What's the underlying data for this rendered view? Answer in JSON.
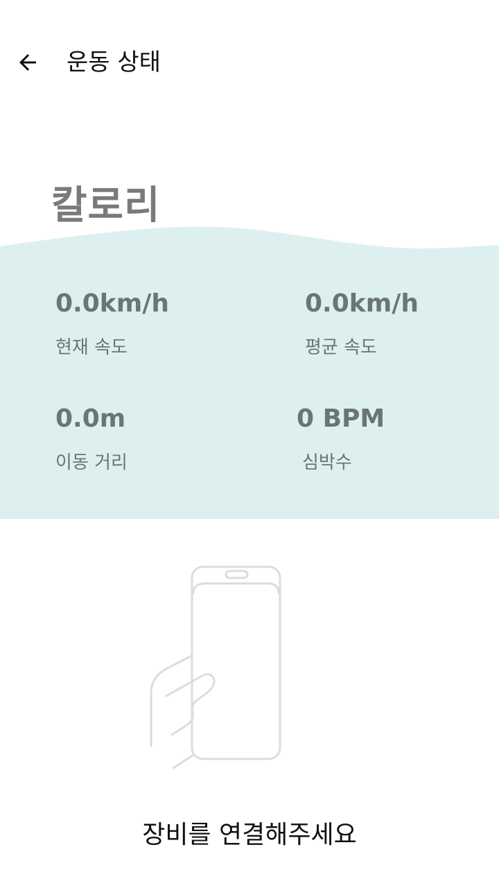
{
  "header": {
    "title": "운동 상태",
    "back_icon": "arrow-left-icon"
  },
  "calorie": {
    "title": "칼로리"
  },
  "stats": {
    "current_speed": {
      "value": "0.0km/h",
      "label": "현재 속도"
    },
    "average_speed": {
      "value": "0.0km/h",
      "label": "평균 속도"
    },
    "distance": {
      "value": "0.0m",
      "label": "이동 거리"
    },
    "heart_rate": {
      "value": "0 BPM",
      "label": "심박수"
    }
  },
  "device": {
    "illustration_icon": "hand-holding-phone-icon",
    "message": "장비를 연결해주세요"
  },
  "colors": {
    "panel_background": "#ddf0ef",
    "stat_text": "#6b7573",
    "calorie_title": "#7a7a7a"
  }
}
